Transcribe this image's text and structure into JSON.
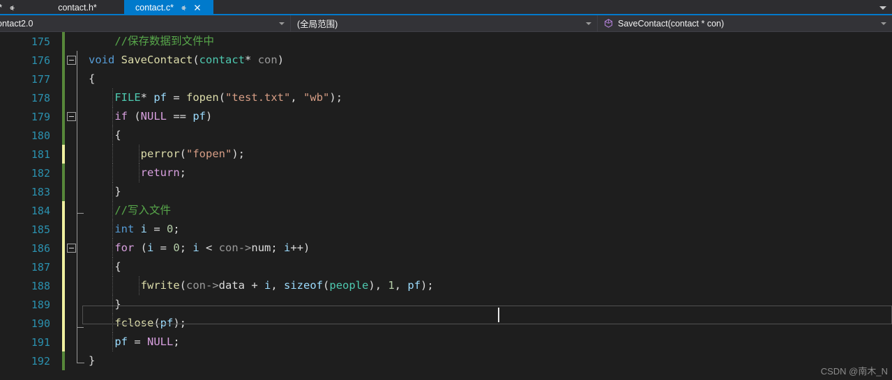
{
  "window": {
    "accent_color": "#007acc",
    "editor_bg": "#1e1e1e",
    "chrome_bg": "#2d2d30",
    "navbar_bg": "#333337"
  },
  "tabs": [
    {
      "label": "c*",
      "active": false,
      "partial": true,
      "pinned": true,
      "closable": false
    },
    {
      "label": "contact.h*",
      "active": false,
      "partial": false,
      "pinned": false,
      "closable": false
    },
    {
      "label": "contact.c*",
      "active": true,
      "partial": false,
      "pinned": true,
      "closable": true
    }
  ],
  "tab_overflow_icon": "chevron-down-icon",
  "navbar": {
    "project": "ontact2.0",
    "scope": "(全局范围)",
    "member": "SaveContact(contact * con)",
    "member_icon": "method-icon",
    "dropdown_icon": "chevron-down-icon"
  },
  "editor": {
    "first_line_number": 175,
    "current_line": 188,
    "lines": [
      {
        "num": 175,
        "change": "green",
        "fold": "none",
        "indent_guides": [],
        "tokens": [
          {
            "t": "    ",
            "c": "plain"
          },
          {
            "t": "//保存数据到文件中",
            "c": "comment"
          }
        ]
      },
      {
        "num": 176,
        "change": "green",
        "fold": "collapse",
        "indent_guides": [],
        "tokens": [
          {
            "t": "void",
            "c": "kw"
          },
          {
            "t": " ",
            "c": "plain"
          },
          {
            "t": "SaveContact",
            "c": "fn"
          },
          {
            "t": "(",
            "c": "punc"
          },
          {
            "t": "contact",
            "c": "type"
          },
          {
            "t": "*",
            "c": "plain"
          },
          {
            "t": " ",
            "c": "plain"
          },
          {
            "t": "con",
            "c": "gray"
          },
          {
            "t": ")",
            "c": "punc"
          }
        ]
      },
      {
        "num": 177,
        "change": "green",
        "fold": "none",
        "indent_guides": [],
        "tokens": [
          {
            "t": "{",
            "c": "punc"
          }
        ]
      },
      {
        "num": 178,
        "change": "green",
        "fold": "none",
        "indent_guides": [
          4
        ],
        "tokens": [
          {
            "t": "    ",
            "c": "plain"
          },
          {
            "t": "FILE",
            "c": "type"
          },
          {
            "t": "*",
            "c": "plain"
          },
          {
            "t": " ",
            "c": "plain"
          },
          {
            "t": "pf",
            "c": "var"
          },
          {
            "t": " = ",
            "c": "plain"
          },
          {
            "t": "fopen",
            "c": "fn"
          },
          {
            "t": "(",
            "c": "punc"
          },
          {
            "t": "\"test.txt\"",
            "c": "str"
          },
          {
            "t": ", ",
            "c": "punc"
          },
          {
            "t": "\"wb\"",
            "c": "str"
          },
          {
            "t": ");",
            "c": "punc"
          }
        ]
      },
      {
        "num": 179,
        "change": "green",
        "fold": "collapse",
        "indent_guides": [
          4
        ],
        "tokens": [
          {
            "t": "    ",
            "c": "plain"
          },
          {
            "t": "if",
            "c": "ctrl"
          },
          {
            "t": " (",
            "c": "punc"
          },
          {
            "t": "NULL",
            "c": "macro"
          },
          {
            "t": " == ",
            "c": "plain"
          },
          {
            "t": "pf",
            "c": "var"
          },
          {
            "t": ")",
            "c": "punc"
          }
        ]
      },
      {
        "num": 180,
        "change": "green",
        "fold": "none",
        "indent_guides": [
          4
        ],
        "tokens": [
          {
            "t": "    ",
            "c": "plain"
          },
          {
            "t": "{",
            "c": "punc"
          }
        ]
      },
      {
        "num": 181,
        "change": "yellow",
        "fold": "none",
        "indent_guides": [
          4,
          8
        ],
        "tokens": [
          {
            "t": "        ",
            "c": "plain"
          },
          {
            "t": "perror",
            "c": "fn"
          },
          {
            "t": "(",
            "c": "punc"
          },
          {
            "t": "\"fopen\"",
            "c": "str"
          },
          {
            "t": ");",
            "c": "punc"
          }
        ]
      },
      {
        "num": 182,
        "change": "green",
        "fold": "none",
        "indent_guides": [
          4,
          8
        ],
        "tokens": [
          {
            "t": "        ",
            "c": "plain"
          },
          {
            "t": "return",
            "c": "ctrl"
          },
          {
            "t": ";",
            "c": "punc"
          }
        ]
      },
      {
        "num": 183,
        "change": "green",
        "fold": "none",
        "indent_guides": [
          4
        ],
        "tokens": [
          {
            "t": "    ",
            "c": "plain"
          },
          {
            "t": "}",
            "c": "punc"
          }
        ]
      },
      {
        "num": 184,
        "change": "yellow",
        "fold": "none",
        "indent_guides": [
          4
        ],
        "tokens": [
          {
            "t": "    ",
            "c": "plain"
          },
          {
            "t": "//写入文件",
            "c": "comment"
          }
        ]
      },
      {
        "num": 185,
        "change": "yellow",
        "fold": "none",
        "indent_guides": [
          4
        ],
        "tokens": [
          {
            "t": "    ",
            "c": "plain"
          },
          {
            "t": "int",
            "c": "kw"
          },
          {
            "t": " ",
            "c": "plain"
          },
          {
            "t": "i",
            "c": "var"
          },
          {
            "t": " = ",
            "c": "plain"
          },
          {
            "t": "0",
            "c": "num"
          },
          {
            "t": ";",
            "c": "punc"
          }
        ]
      },
      {
        "num": 186,
        "change": "yellow",
        "fold": "collapse",
        "indent_guides": [
          4
        ],
        "tokens": [
          {
            "t": "    ",
            "c": "plain"
          },
          {
            "t": "for",
            "c": "ctrl"
          },
          {
            "t": " (",
            "c": "punc"
          },
          {
            "t": "i",
            "c": "var"
          },
          {
            "t": " = ",
            "c": "plain"
          },
          {
            "t": "0",
            "c": "num"
          },
          {
            "t": "; ",
            "c": "punc"
          },
          {
            "t": "i",
            "c": "var"
          },
          {
            "t": " < ",
            "c": "plain"
          },
          {
            "t": "con",
            "c": "gray"
          },
          {
            "t": "->",
            "c": "gray"
          },
          {
            "t": "num",
            "c": "plain"
          },
          {
            "t": "; ",
            "c": "punc"
          },
          {
            "t": "i",
            "c": "var"
          },
          {
            "t": "++)",
            "c": "punc"
          }
        ]
      },
      {
        "num": 187,
        "change": "yellow",
        "fold": "none",
        "indent_guides": [
          4
        ],
        "tokens": [
          {
            "t": "    ",
            "c": "plain"
          },
          {
            "t": "{",
            "c": "punc"
          }
        ]
      },
      {
        "num": 188,
        "change": "yellow",
        "fold": "none",
        "indent_guides": [
          4,
          8
        ],
        "tokens": [
          {
            "t": "        ",
            "c": "plain"
          },
          {
            "t": "fwrite",
            "c": "fn"
          },
          {
            "t": "(",
            "c": "punc"
          },
          {
            "t": "con",
            "c": "gray"
          },
          {
            "t": "->",
            "c": "gray"
          },
          {
            "t": "data",
            "c": "plain"
          },
          {
            "t": " + ",
            "c": "plain"
          },
          {
            "t": "i",
            "c": "var"
          },
          {
            "t": ", ",
            "c": "punc"
          },
          {
            "t": "sizeof",
            "c": "var"
          },
          {
            "t": "(",
            "c": "punc"
          },
          {
            "t": "people",
            "c": "type"
          },
          {
            "t": "), ",
            "c": "punc"
          },
          {
            "t": "1",
            "c": "num"
          },
          {
            "t": ", ",
            "c": "punc"
          },
          {
            "t": "pf",
            "c": "var"
          },
          {
            "t": ");",
            "c": "punc"
          }
        ]
      },
      {
        "num": 189,
        "change": "yellow",
        "fold": "none",
        "indent_guides": [
          4
        ],
        "tokens": [
          {
            "t": "    ",
            "c": "plain"
          },
          {
            "t": "}",
            "c": "punc"
          }
        ]
      },
      {
        "num": 190,
        "change": "yellow",
        "fold": "none",
        "indent_guides": [
          4
        ],
        "tokens": [
          {
            "t": "    ",
            "c": "plain"
          },
          {
            "t": "fclose",
            "c": "fn"
          },
          {
            "t": "(",
            "c": "punc"
          },
          {
            "t": "pf",
            "c": "var"
          },
          {
            "t": ");",
            "c": "punc"
          }
        ]
      },
      {
        "num": 191,
        "change": "yellow",
        "fold": "none",
        "indent_guides": [
          4
        ],
        "tokens": [
          {
            "t": "    ",
            "c": "plain"
          },
          {
            "t": "pf",
            "c": "var"
          },
          {
            "t": " = ",
            "c": "plain"
          },
          {
            "t": "NULL",
            "c": "macro"
          },
          {
            "t": ";",
            "c": "punc"
          }
        ]
      },
      {
        "num": 192,
        "change": "green",
        "fold": "none",
        "indent_guides": [],
        "tokens": [
          {
            "t": "}",
            "c": "punc"
          }
        ]
      }
    ]
  },
  "watermark": "CSDN @南木_N"
}
